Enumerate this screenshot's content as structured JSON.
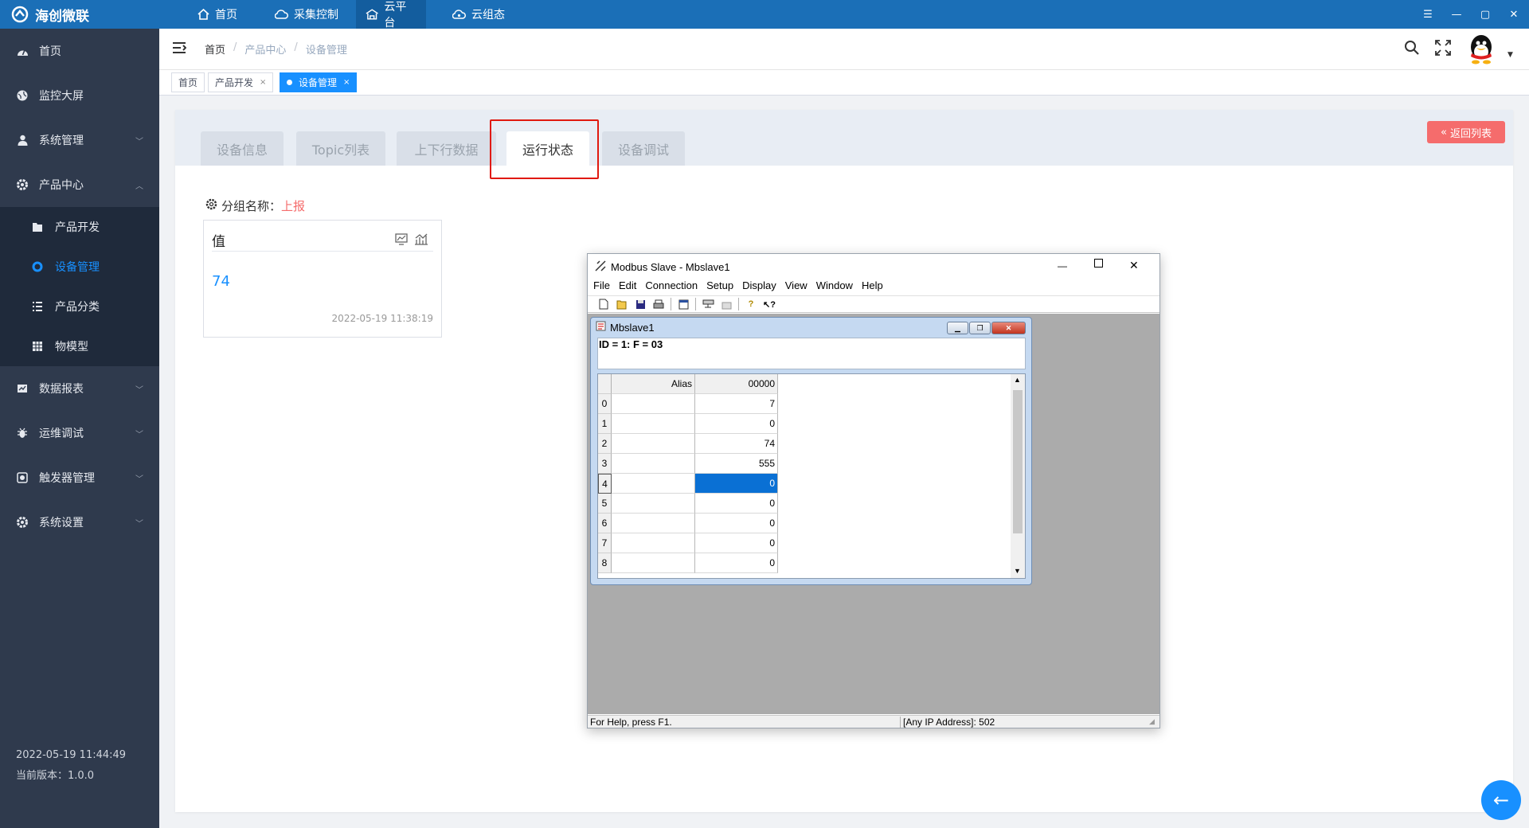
{
  "app": {
    "logo_text": "海创微联",
    "colors": {
      "primary": "#1b6fb7",
      "sidebar": "#2f3a4d",
      "accent": "#1890ff",
      "danger": "#f56c6c"
    }
  },
  "topnav": [
    {
      "label": "首页",
      "icon": "home-icon"
    },
    {
      "label": "采集控制",
      "icon": "cloud-sync-icon"
    },
    {
      "label": "云平台",
      "icon": "cloud-platform-icon"
    },
    {
      "label": "云组态",
      "icon": "cloud-config-icon"
    }
  ],
  "sidebar": {
    "items": [
      {
        "label": "首页"
      },
      {
        "label": "监控大屏"
      },
      {
        "label": "系统管理"
      },
      {
        "label": "产品中心"
      },
      {
        "label": "数据报表"
      },
      {
        "label": "运维调试"
      },
      {
        "label": "触发器管理"
      },
      {
        "label": "系统设置"
      }
    ],
    "sub": [
      {
        "label": "产品开发"
      },
      {
        "label": "设备管理"
      },
      {
        "label": "产品分类"
      },
      {
        "label": "物模型"
      }
    ],
    "footer": {
      "datetime": "2022-05-19 11:44:49",
      "version": "当前版本：1.0.0"
    }
  },
  "breadcrumb": [
    "首页",
    "产品中心",
    "设备管理"
  ],
  "tags": [
    "首页",
    "产品开发",
    "设备管理"
  ],
  "content": {
    "tabs": [
      "设备信息",
      "Topic列表",
      "上下行数据",
      "运行状态",
      "设备调试"
    ],
    "back_button": "返回列表",
    "group_label": "分组名称：",
    "group_value": "上报",
    "card": {
      "title": "值",
      "value": "74",
      "timestamp": "2022-05-19 11:38:19"
    }
  },
  "modbus": {
    "title": "Modbus Slave - Mbslave1",
    "menu": [
      "File",
      "Edit",
      "Connection",
      "Setup",
      "Display",
      "View",
      "Window",
      "Help"
    ],
    "child_title": "Mbslave1",
    "id_line": "ID = 1: F = 03",
    "grid_headers": [
      "Alias",
      "00000"
    ],
    "rows": [
      {
        "idx": "0",
        "val": "7"
      },
      {
        "idx": "1",
        "val": "0"
      },
      {
        "idx": "2",
        "val": "74"
      },
      {
        "idx": "3",
        "val": "555"
      },
      {
        "idx": "4",
        "val": "0"
      },
      {
        "idx": "5",
        "val": "0"
      },
      {
        "idx": "6",
        "val": "0"
      },
      {
        "idx": "7",
        "val": "0"
      },
      {
        "idx": "8",
        "val": "0"
      }
    ],
    "status_left": "For Help, press F1.",
    "status_right": "[Any IP Address]: 502"
  }
}
